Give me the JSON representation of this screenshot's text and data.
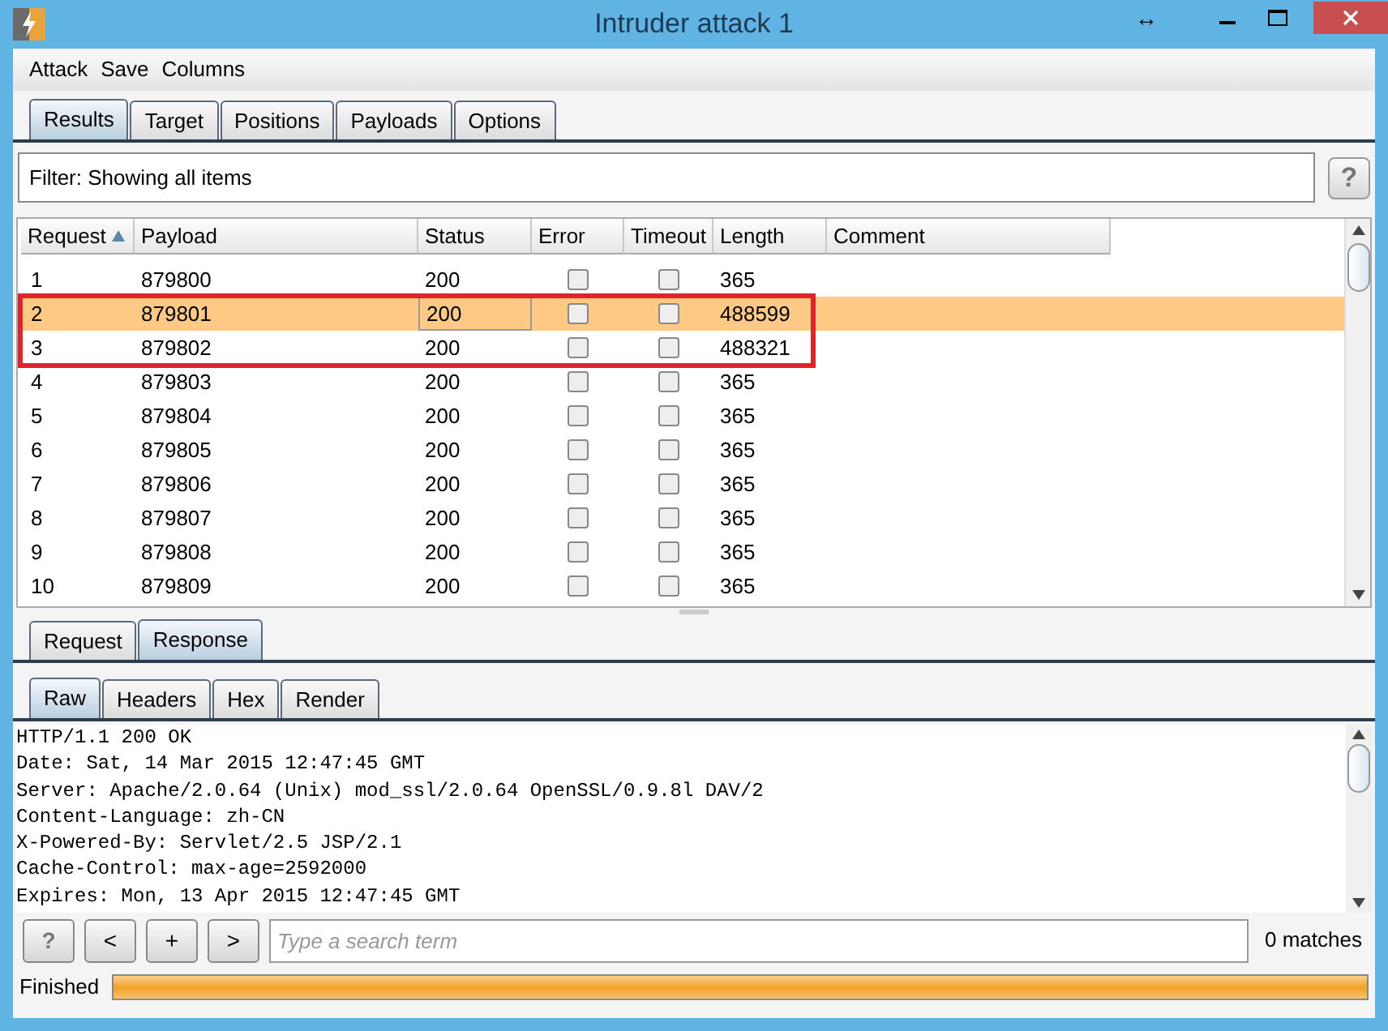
{
  "window": {
    "title": "Intruder attack 1",
    "resize_glyph": "↔"
  },
  "menu": [
    "Attack",
    "Save",
    "Columns"
  ],
  "tabs": [
    {
      "label": "Results",
      "selected": true
    },
    {
      "label": "Target",
      "selected": false
    },
    {
      "label": "Positions",
      "selected": false
    },
    {
      "label": "Payloads",
      "selected": false
    },
    {
      "label": "Options",
      "selected": false
    }
  ],
  "filter": {
    "text": "Filter: Showing all items",
    "help": "?"
  },
  "table": {
    "columns": [
      {
        "label": "Request",
        "sorted": true
      },
      {
        "label": "Payload",
        "sorted": false
      },
      {
        "label": "Status",
        "sorted": false
      },
      {
        "label": "Error",
        "sorted": false
      },
      {
        "label": "Timeout",
        "sorted": false
      },
      {
        "label": "Length",
        "sorted": false
      },
      {
        "label": "Comment",
        "sorted": false
      }
    ],
    "rows": [
      {
        "request": "1",
        "payload": "879800",
        "status": "200",
        "error": false,
        "timeout": false,
        "length": "365",
        "selected": false,
        "marked": false
      },
      {
        "request": "2",
        "payload": "879801",
        "status": "200",
        "error": false,
        "timeout": false,
        "length": "488599",
        "selected": true,
        "marked": true
      },
      {
        "request": "3",
        "payload": "879802",
        "status": "200",
        "error": false,
        "timeout": false,
        "length": "488321",
        "selected": false,
        "marked": true
      },
      {
        "request": "4",
        "payload": "879803",
        "status": "200",
        "error": false,
        "timeout": false,
        "length": "365",
        "selected": false,
        "marked": false
      },
      {
        "request": "5",
        "payload": "879804",
        "status": "200",
        "error": false,
        "timeout": false,
        "length": "365",
        "selected": false,
        "marked": false
      },
      {
        "request": "6",
        "payload": "879805",
        "status": "200",
        "error": false,
        "timeout": false,
        "length": "365",
        "selected": false,
        "marked": false
      },
      {
        "request": "7",
        "payload": "879806",
        "status": "200",
        "error": false,
        "timeout": false,
        "length": "365",
        "selected": false,
        "marked": false
      },
      {
        "request": "8",
        "payload": "879807",
        "status": "200",
        "error": false,
        "timeout": false,
        "length": "365",
        "selected": false,
        "marked": false
      },
      {
        "request": "9",
        "payload": "879808",
        "status": "200",
        "error": false,
        "timeout": false,
        "length": "365",
        "selected": false,
        "marked": false
      },
      {
        "request": "10",
        "payload": "879809",
        "status": "200",
        "error": false,
        "timeout": false,
        "length": "365",
        "selected": false,
        "marked": false
      }
    ]
  },
  "message_tabs": [
    {
      "label": "Request",
      "selected": false
    },
    {
      "label": "Response",
      "selected": true
    }
  ],
  "view_tabs": [
    {
      "label": "Raw",
      "selected": true
    },
    {
      "label": "Headers",
      "selected": false
    },
    {
      "label": "Hex",
      "selected": false
    },
    {
      "label": "Render",
      "selected": false
    }
  ],
  "response_lines": [
    "HTTP/1.1 200 OK",
    "Date: Sat, 14 Mar 2015 12:47:45 GMT",
    "Server: Apache/2.0.64 (Unix) mod_ssl/2.0.64 OpenSSL/0.9.8l DAV/2",
    "Content-Language: zh-CN",
    "X-Powered-By: Servlet/2.5 JSP/2.1",
    "Cache-Control: max-age=2592000",
    "Expires: Mon, 13 Apr 2015 12:47:45 GMT"
  ],
  "search": {
    "buttons": [
      "?",
      "<",
      "+",
      ">"
    ],
    "placeholder": "Type a search term",
    "matches": "0 matches"
  },
  "status_bar": {
    "text": "Finished",
    "level": 1
  }
}
